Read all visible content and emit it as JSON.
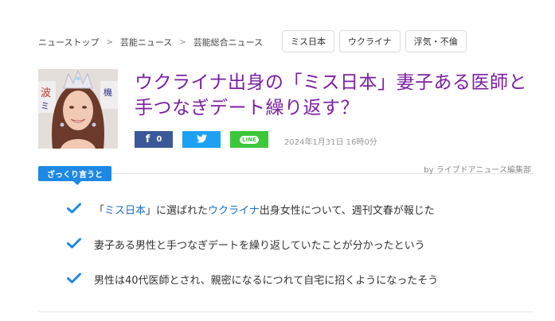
{
  "breadcrumb": {
    "items": [
      "ニューストップ",
      "芸能ニュース",
      "芸能総合ニュース"
    ],
    "separator": ">"
  },
  "tags": [
    "ミス日本",
    "ウクライナ",
    "浮気・不倫"
  ],
  "article": {
    "title": "ウクライナ出身の「ミス日本」妻子ある医師と手つなぎデート繰り返す？",
    "date": "2024年1月31日 16時0分",
    "byline": "by ライブドアニュース編集部"
  },
  "share": {
    "facebook_count": "0",
    "line_label": "LINE",
    "colors": {
      "facebook": "#3b5998",
      "twitter": "#1da1f2",
      "line": "#3ac73a"
    }
  },
  "summary": {
    "label": "ざっくり言うと",
    "items": [
      {
        "pre": "「",
        "link1": "ミス日本",
        "mid": "」に選ばれた",
        "link2": "ウクライナ",
        "post": "出身女性について、週刊文春が報じた"
      },
      {
        "text": "妻子ある男性と手つなぎデートを繰り返していたことが分かったという"
      },
      {
        "text": "男性は40代医師とされ、親密になるにつれて自宅に招くようになったそう"
      }
    ]
  },
  "colors": {
    "title": "#7b1fa2",
    "accent": "#1e88e5",
    "link": "#1e6fbf"
  },
  "icons": {
    "check": "check-icon",
    "facebook": "facebook-icon",
    "twitter": "twitter-icon",
    "line": "line-icon",
    "breadcrumb_sep": "chevron-right-icon"
  }
}
